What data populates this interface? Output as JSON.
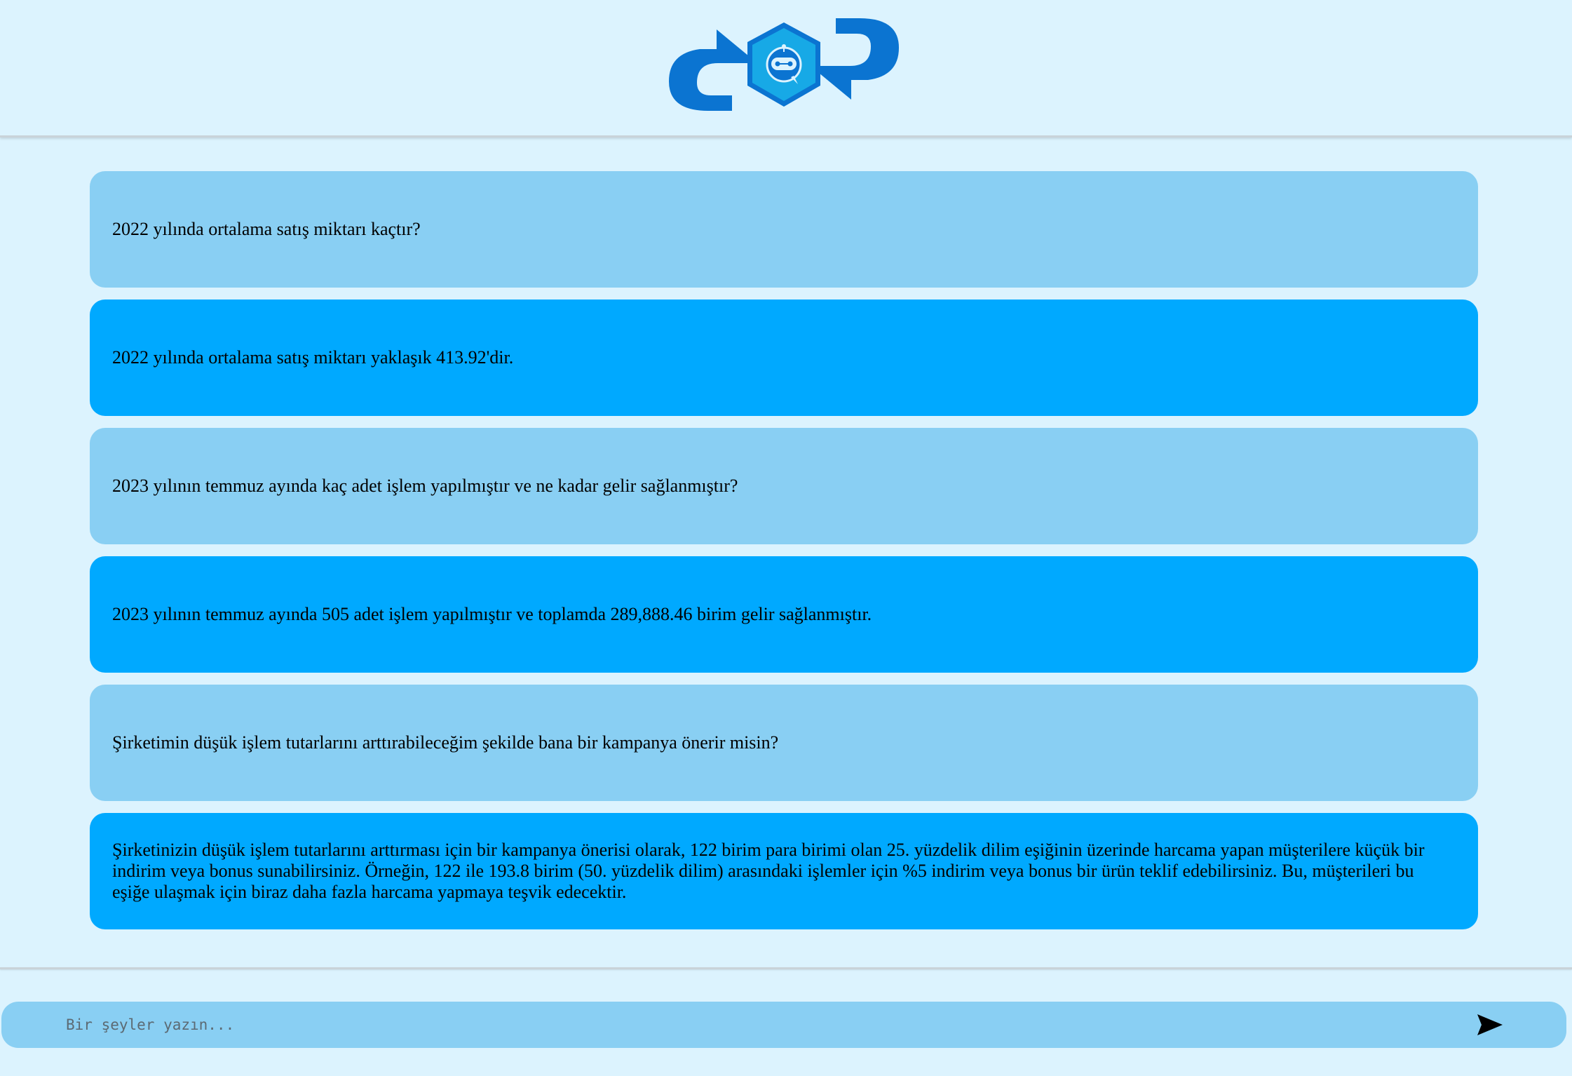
{
  "header": {
    "logo_icon": "chatbot-refresh-logo",
    "colors": {
      "logo_blue": "#0b74d1",
      "hex_fill": "#17a9e6"
    }
  },
  "messages": [
    {
      "role": "user",
      "text": "2022 yılında ortalama satış miktarı kaçtır?"
    },
    {
      "role": "bot",
      "text": "2022 yılında ortalama satış miktarı yaklaşık 413.92'dir."
    },
    {
      "role": "user",
      "text": "2023 yılının temmuz ayında kaç adet işlem yapılmıştır ve ne kadar gelir sağlanmıştır?"
    },
    {
      "role": "bot",
      "text": "2023 yılının temmuz ayında 505 adet işlem yapılmıştır ve toplamda 289,888.46 birim gelir sağlanmıştır."
    },
    {
      "role": "user",
      "text": "Şirketimin düşük işlem tutarlarını arttırabileceğim şekilde bana bir kampanya önerir misin?"
    },
    {
      "role": "bot",
      "text": "Şirketinizin düşük işlem tutarlarını arttırması için bir kampanya önerisi olarak, 122 birim para birimi olan 25. yüzdelik dilim eşiğinin üzerinde harcama yapan müşterilere küçük bir indirim veya bonus sunabilirsiniz. Örneğin, 122 ile 193.8 birim (50. yüzdelik dilim) arasındaki işlemler için %5 indirim veya bonus bir ürün teklif edebilirsiniz. Bu, müşterileri bu eşiğe ulaşmak için biraz daha fazla harcama yapmaya teşvik edecektir."
    }
  ],
  "input": {
    "placeholder": "Bir şeyler yazın...",
    "value": "",
    "send_icon": "send-icon"
  },
  "colors": {
    "background": "#dcf3fe",
    "user_bubble": "#89cff3",
    "bot_bubble": "#00a9ff"
  }
}
